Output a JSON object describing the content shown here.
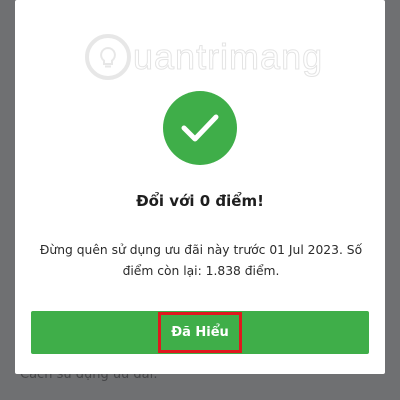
{
  "background": {
    "hint_text": "Cách sử dụng ưu đãi:"
  },
  "watermark": {
    "text": "uantrimang",
    "icon": "lightbulb-icon"
  },
  "dialog": {
    "icon": "checkmark-icon",
    "title": "Đổi với 0 điểm!",
    "message": "Đừng quên sử dụng ưu đãi này trước 01 Jul 2023. Số điểm còn lại: 1.838 điểm.",
    "button_label": "Đã Hiểu"
  },
  "colors": {
    "accent_green": "#3fae49",
    "highlight_red": "#e0181e",
    "overlay_gray": "#6f7072"
  }
}
